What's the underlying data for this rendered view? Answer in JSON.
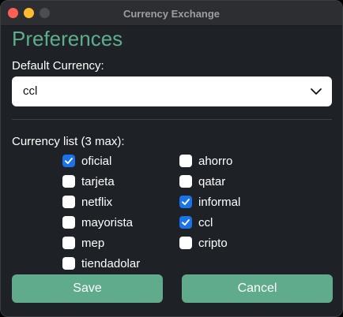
{
  "window": {
    "title": "Currency Exchange"
  },
  "preferences": {
    "heading": "Preferences",
    "default_currency_label": "Default Currency:",
    "default_currency_value": "ccl",
    "currency_list_label": "Currency list (3 max):"
  },
  "currencies": {
    "left": [
      {
        "label": "oficial",
        "checked": true
      },
      {
        "label": "tarjeta",
        "checked": false
      },
      {
        "label": "netflix",
        "checked": false
      },
      {
        "label": "mayorista",
        "checked": false
      },
      {
        "label": "mep",
        "checked": false
      },
      {
        "label": "tiendadolar",
        "checked": false
      }
    ],
    "right": [
      {
        "label": "ahorro",
        "checked": false
      },
      {
        "label": "qatar",
        "checked": false
      },
      {
        "label": "informal",
        "checked": true
      },
      {
        "label": "ccl",
        "checked": true
      },
      {
        "label": "cripto",
        "checked": false
      }
    ]
  },
  "buttons": {
    "save": "Save",
    "cancel": "Cancel"
  },
  "colors": {
    "accent": "#5fad8c",
    "checkbox_checked": "#1a73e8",
    "background": "#1e2227"
  },
  "icons": {
    "select_arrow": "chevron-down-icon",
    "check": "checkmark-icon"
  }
}
